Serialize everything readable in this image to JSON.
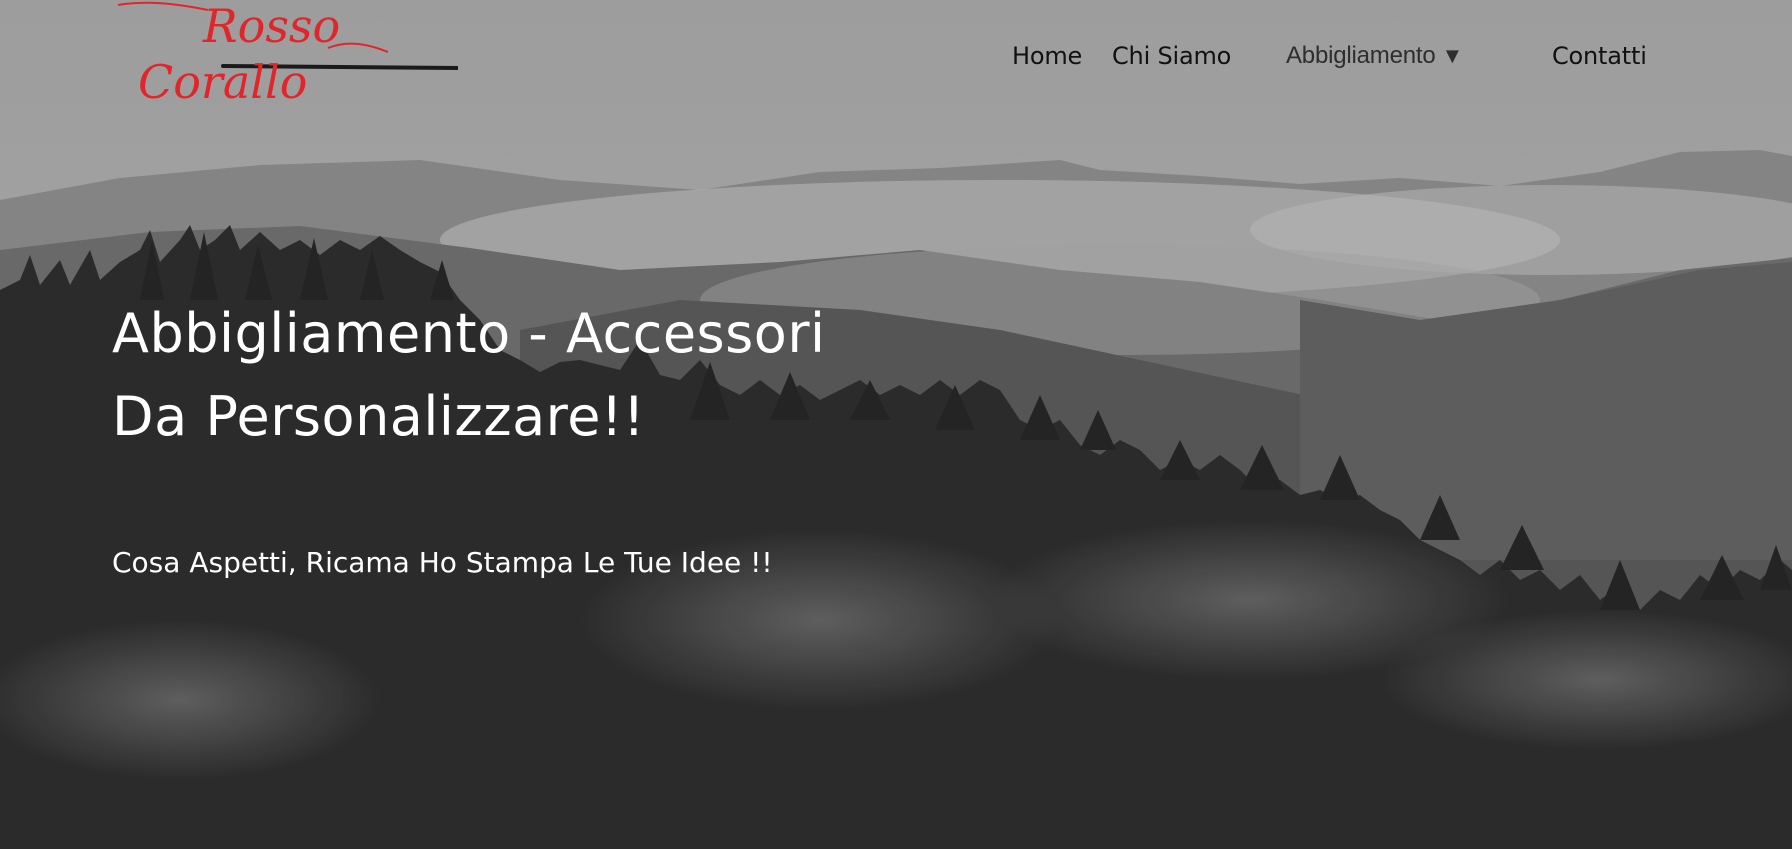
{
  "logo": {
    "line1": "Rosso",
    "line2": "Corallo",
    "color": "#e0262a"
  },
  "nav": {
    "home": "Home",
    "chi_siamo": "Chi Siamo",
    "abbigliamento": "Abbigliamento",
    "abbigliamento_caret": "▼",
    "contatti": "Contatti"
  },
  "hero": {
    "title_line1": "Abbigliamento - Accessori",
    "title_line2": "Da Personalizzare!!",
    "subtitle": "Cosa Aspetti, Ricama Ho Stampa Le Tue Idee !!"
  },
  "colors": {
    "nav_text": "#111111",
    "hero_text": "#ffffff",
    "sky": "#a9a9a9"
  }
}
